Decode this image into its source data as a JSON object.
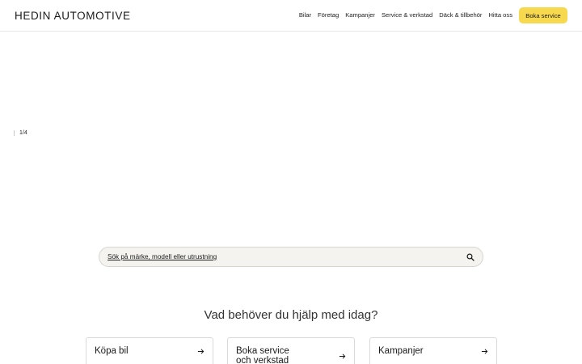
{
  "header": {
    "logo": "HEDIN AUTOMOTIVE",
    "nav": [
      "Bilar",
      "Företag",
      "Kampanjer",
      "Service & verkstad",
      "Däck & tillbehör",
      "Hitta oss"
    ],
    "cta_label": "Boka service",
    "cta_color": "#f6d94f"
  },
  "hero": {
    "slide_counter": "1/4"
  },
  "search": {
    "placeholder": "Sök på märke, modell eller utrustning",
    "icon": "search-icon"
  },
  "help": {
    "title": "Vad behöver du hjälp med idag?"
  },
  "cards": [
    {
      "label": "Köpa bil",
      "icon": "arrow-right-icon"
    },
    {
      "label_line1": "Boka service",
      "label_line2": "och verkstad",
      "icon": "arrow-right-icon"
    },
    {
      "label": "Kampanjer",
      "icon": "arrow-right-icon"
    }
  ]
}
